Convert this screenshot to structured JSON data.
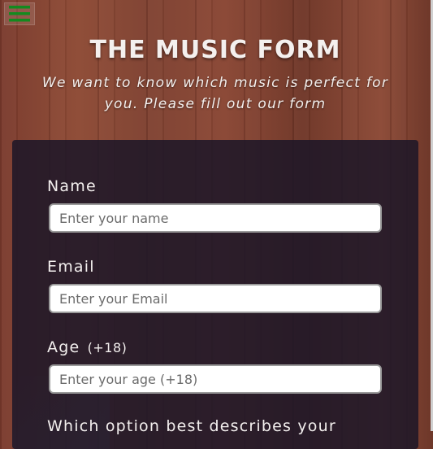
{
  "header": {
    "title": "THE MUSIC FORM",
    "subtitle": "We want to know which music is perfect for you. Please fill out our form"
  },
  "menu": {
    "icon": "hamburger-icon",
    "color": "#138a1f"
  },
  "form": {
    "name": {
      "label": "Name",
      "placeholder": "Enter your name"
    },
    "email": {
      "label": "Email",
      "placeholder": "Enter your Email"
    },
    "age": {
      "label": "Age",
      "note": "(+18)",
      "placeholder": "Enter your age (+18)"
    },
    "question": {
      "label": "Which option best describes your"
    }
  },
  "colors": {
    "panel": "#1c1628",
    "wood": "#7f4131"
  }
}
